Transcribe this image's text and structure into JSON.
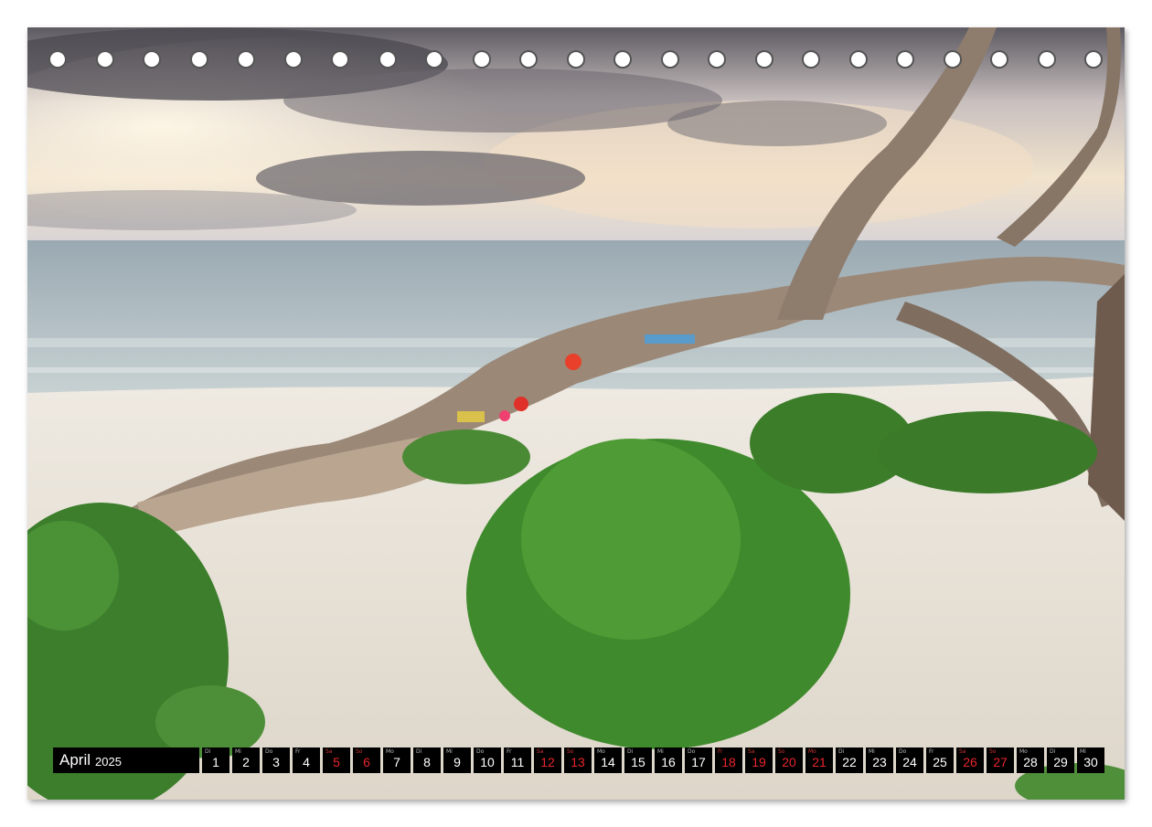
{
  "calendar": {
    "month": "April",
    "year": "2025",
    "days": [
      {
        "dow": "Di",
        "num": "1",
        "weekend": false
      },
      {
        "dow": "Mi",
        "num": "2",
        "weekend": false
      },
      {
        "dow": "Do",
        "num": "3",
        "weekend": false
      },
      {
        "dow": "Fr",
        "num": "4",
        "weekend": false
      },
      {
        "dow": "Sa",
        "num": "5",
        "weekend": true
      },
      {
        "dow": "So",
        "num": "6",
        "weekend": true
      },
      {
        "dow": "Mo",
        "num": "7",
        "weekend": false
      },
      {
        "dow": "Di",
        "num": "8",
        "weekend": false
      },
      {
        "dow": "Mi",
        "num": "9",
        "weekend": false
      },
      {
        "dow": "Do",
        "num": "10",
        "weekend": false
      },
      {
        "dow": "Fr",
        "num": "11",
        "weekend": false
      },
      {
        "dow": "Sa",
        "num": "12",
        "weekend": true
      },
      {
        "dow": "So",
        "num": "13",
        "weekend": true
      },
      {
        "dow": "Mo",
        "num": "14",
        "weekend": false
      },
      {
        "dow": "Di",
        "num": "15",
        "weekend": false
      },
      {
        "dow": "Mi",
        "num": "16",
        "weekend": false
      },
      {
        "dow": "Do",
        "num": "17",
        "weekend": false
      },
      {
        "dow": "Fr",
        "num": "18",
        "weekend": true
      },
      {
        "dow": "Sa",
        "num": "19",
        "weekend": true
      },
      {
        "dow": "So",
        "num": "20",
        "weekend": true
      },
      {
        "dow": "Mo",
        "num": "21",
        "weekend": true
      },
      {
        "dow": "Di",
        "num": "22",
        "weekend": false
      },
      {
        "dow": "Mi",
        "num": "23",
        "weekend": false
      },
      {
        "dow": "Do",
        "num": "24",
        "weekend": false
      },
      {
        "dow": "Fr",
        "num": "25",
        "weekend": false
      },
      {
        "dow": "Sa",
        "num": "26",
        "weekend": true
      },
      {
        "dow": "So",
        "num": "27",
        "weekend": true
      },
      {
        "dow": "Mo",
        "num": "28",
        "weekend": false
      },
      {
        "dow": "Di",
        "num": "29",
        "weekend": false
      },
      {
        "dow": "Mi",
        "num": "30",
        "weekend": false
      }
    ]
  },
  "binding": {
    "hole_count": 23
  },
  "colors": {
    "sky_top": "#6e6a70",
    "sky_glow": "#f3e6d0",
    "sea": "#aebcc2",
    "sand": "#e9e4da",
    "driftwood": "#9b8877",
    "grass": "#3f8a2c",
    "weekend_red": "#e8252d",
    "bar_black": "#000000"
  }
}
